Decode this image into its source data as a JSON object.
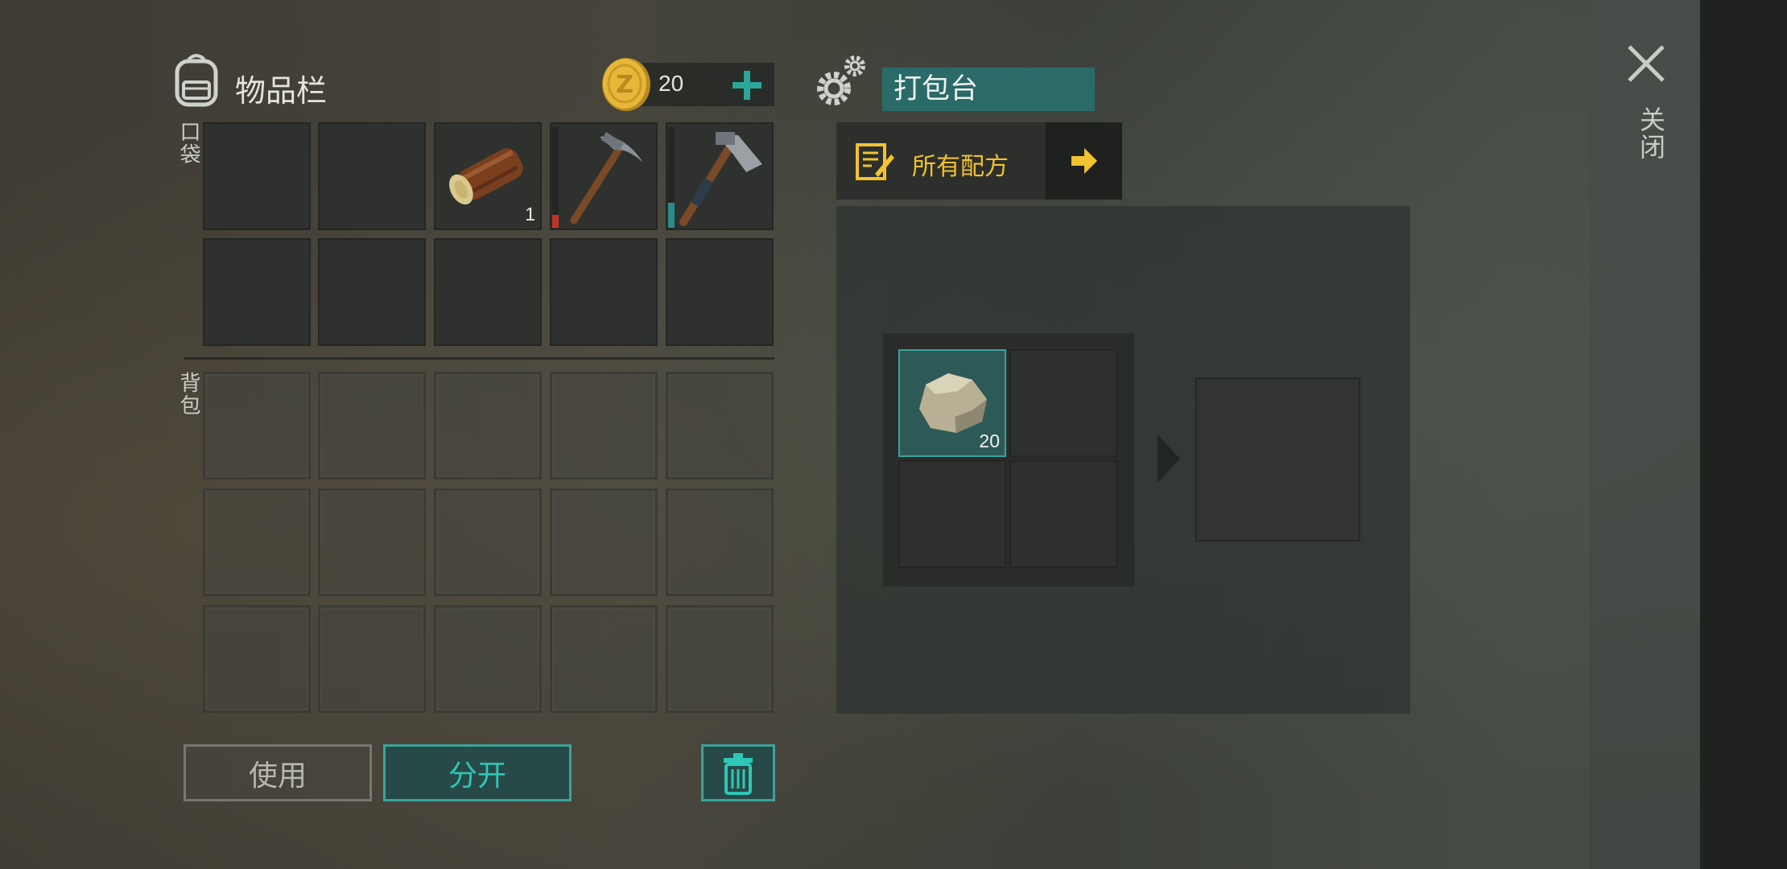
{
  "inventory": {
    "title": "物品栏",
    "coins": "20",
    "pocket_label": "口袋",
    "backpack_label": "背包",
    "pocket_slots": [
      {
        "item": ""
      },
      {
        "item": ""
      },
      {
        "item": "log",
        "count": "1"
      },
      {
        "item": "pickaxe"
      },
      {
        "item": "hatchet"
      },
      {
        "item": ""
      },
      {
        "item": ""
      },
      {
        "item": ""
      },
      {
        "item": ""
      },
      {
        "item": ""
      }
    ],
    "use_label": "使用",
    "split_label": "分开"
  },
  "crafting": {
    "station_name": "打包台",
    "recipes_label": "所有配方",
    "input_slots": [
      {
        "item": "stone",
        "count": "20"
      },
      {
        "item": ""
      },
      {
        "item": ""
      },
      {
        "item": ""
      }
    ],
    "output_slot": {
      "item": ""
    }
  },
  "close_label": "关闭",
  "colors": {
    "accent_teal": "#2a6a68",
    "teal_border": "#3aa39c",
    "recipe_yellow": "#f2c230",
    "coin_gold": "#e7b73a"
  },
  "icons": [
    "backpack-icon",
    "coin-icon",
    "plus-icon",
    "gears-icon",
    "recipe-book-icon",
    "arrow-right-icon",
    "trash-icon",
    "close-icon",
    "log-icon",
    "pickaxe-icon",
    "hatchet-icon",
    "stone-icon",
    "craft-arrow-icon"
  ]
}
